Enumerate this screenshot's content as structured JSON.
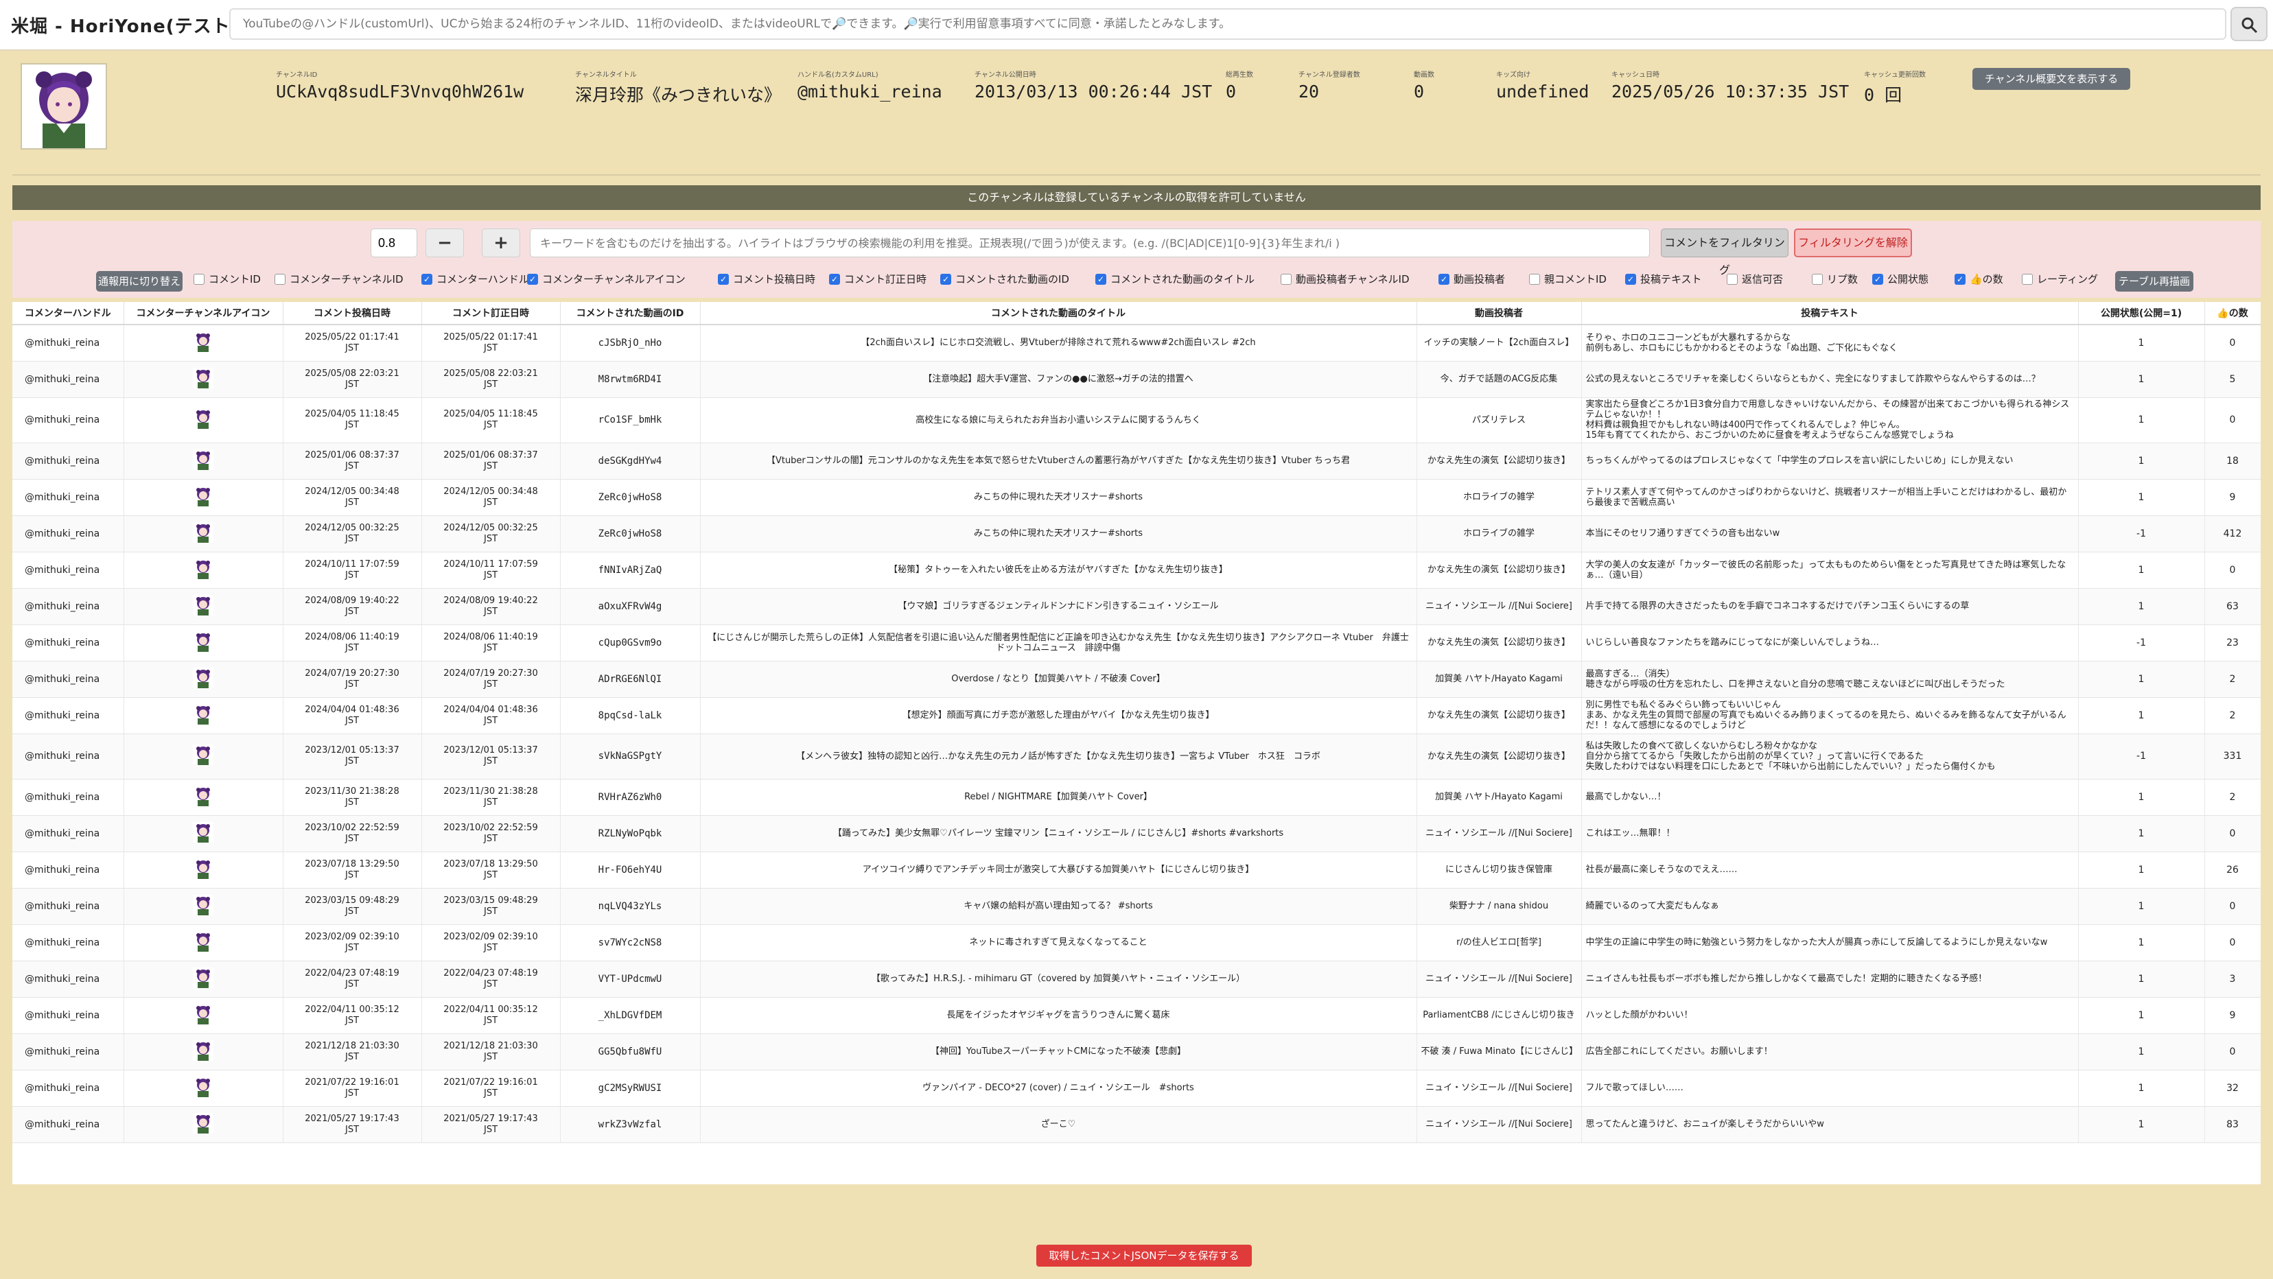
{
  "app_title": "米堀 - HoriYone(テスト中)",
  "search": {
    "placeholder": "YouTubeの@ハンドル(customUrl)、UCから始まる24桁のチャンネルID、11桁のvideoID、またはvideoURLで🔎できます。🔎実行で利用留意事項すべてに同意・承諾したとみなします。"
  },
  "channel": {
    "fields": [
      {
        "label": "チャンネルID",
        "value": "UCkAvq8sudLF3Vnvq0hW261w",
        "mono": true
      },
      {
        "label": "チャンネルタイトル",
        "value": "深月玲那《みつきれいな》",
        "mono": false
      },
      {
        "label": "ハンドル名(カスタムURL)",
        "value": "@mithuki_reina",
        "mono": true
      },
      {
        "label": "チャンネル公開日時",
        "value": "2013/03/13 00:26:44 JST",
        "mono": true
      },
      {
        "label": "総再生数",
        "value": "0",
        "mono": true
      },
      {
        "label": "チャンネル登録者数",
        "value": "20",
        "mono": true
      },
      {
        "label": "動画数",
        "value": "0",
        "mono": true
      },
      {
        "label": "キッズ向け",
        "value": "undefined",
        "mono": true
      },
      {
        "label": "キャッシュ日時",
        "value": "2025/05/26 10:37:35 JST",
        "mono": true
      },
      {
        "label": "キャッシュ更新回数",
        "value": "0 回",
        "mono": true
      }
    ],
    "summary_button": "チャンネル概要文を表示する"
  },
  "banner": "このチャンネルは登録しているチャンネルの取得を許可していません",
  "filter": {
    "threshold": "0.8",
    "minus": "−",
    "plus": "+",
    "keyword_placeholder": "キーワードを含むものだけを抽出する。ハイライトはブラウザの検索機能の利用を推奨。正規表現(/で囲う)が使えます。(e.g. /(BC|AD|CE)1[0-9]{3}年生まれ/i )",
    "filter_button": "コメントをフィルタリング",
    "clear_button": "フィルタリングを解除"
  },
  "mode_button": "通報用に切り替え",
  "redraw_button": "テーブル再描画",
  "columns_toggle": [
    {
      "label": "コメントID",
      "checked": false
    },
    {
      "label": "コメンターチャンネルID",
      "checked": false
    },
    {
      "label": "コメンターハンドル",
      "checked": true
    },
    {
      "label": "コメンターチャンネルアイコン",
      "checked": true
    },
    {
      "label": "コメント投稿日時",
      "checked": true
    },
    {
      "label": "コメント訂正日時",
      "checked": true
    },
    {
      "label": "コメントされた動画のID",
      "checked": true
    },
    {
      "label": "コメントされた動画のタイトル",
      "checked": true
    },
    {
      "label": "動画投稿者チャンネルID",
      "checked": false
    },
    {
      "label": "動画投稿者",
      "checked": true
    },
    {
      "label": "親コメントID",
      "checked": false
    },
    {
      "label": "投稿テキスト",
      "checked": true
    },
    {
      "label": "返信可否",
      "checked": false
    },
    {
      "label": "リプ数",
      "checked": false
    },
    {
      "label": "公開状態",
      "checked": true
    },
    {
      "label": "👍の数",
      "checked": true
    },
    {
      "label": "レーティング",
      "checked": false
    }
  ],
  "table": {
    "headers": [
      "コメンターハンドル",
      "コメンターチャンネルアイコン",
      "コメント投稿日時",
      "コメント訂正日時",
      "コメントされた動画のID",
      "コメントされた動画のタイトル",
      "動画投稿者",
      "投稿テキスト",
      "公開状態(公開=1)",
      "👍の数"
    ],
    "rows": [
      {
        "h": "@mithuki_reina",
        "p1": "2025/05/22 01:17:41",
        "p2": "JST",
        "e1": "2025/05/22 01:17:41",
        "e2": "JST",
        "vid": "cJSbRjO_nHo",
        "title": "【2ch面白いスレ】にじホロ交流戦し、男Vtuberが排除されて荒れるwww#2ch面白いスレ #2ch",
        "up": "イッチの実験ノート【2ch面白スレ】",
        "text": "そりゃ、ホロのユニコーンどもが大暴れするからな\n前例もあし、ホロもにじもかかわるとそのような「ぬ出題、ご下化にもぐなく",
        "pub": "1",
        "likes": "0"
      },
      {
        "h": "@mithuki_reina",
        "p1": "2025/05/08 22:03:21",
        "p2": "JST",
        "e1": "2025/05/08 22:03:21",
        "e2": "JST",
        "vid": "M8rwtm6RD4I",
        "title": "【注意喚起】超大手V運営、ファンの●●に激怒→ガチの法的措置へ",
        "up": "今、ガチで話題のACG反応集",
        "text": "公式の見えないところでリチャを楽しむくらいならともかく、完全になりすまして詐欺やらなんやらするのは…？",
        "pub": "1",
        "likes": "5"
      },
      {
        "h": "@mithuki_reina",
        "p1": "2025/04/05 11:18:45",
        "p2": "JST",
        "e1": "2025/04/05 11:18:45",
        "e2": "JST",
        "vid": "rCo1SF_bmHk",
        "title": "高校生になる娘に与えられたお弁当お小遣いシステムに関するうんちく",
        "up": "パズリテレス",
        "text": "実家出たら昼食どころか1日3食分自力で用意しなきゃいけないんだから、その練習が出来ておこづかいも得られる神システムじゃないか！！\n材料費は親負担でかもしれない時は400円で作ってくれるんでしょ？仲じゃん。\n15年も育ててくれたから、おこづかいのために昼食を考えようぜならこんな感覚でしょうね",
        "pub": "1",
        "likes": "0",
        "tall": true
      },
      {
        "h": "@mithuki_reina",
        "p1": "2025/01/06 08:37:37",
        "p2": "JST",
        "e1": "2025/01/06 08:37:37",
        "e2": "JST",
        "vid": "deSGKgdHYw4",
        "title": "【Vtuberコンサルの闇】元コンサルのかなえ先生を本気で怒らせたVtuberさんの蓄悪行為がヤバすぎた【かなえ先生切り抜き】Vtuber ちっち君",
        "up": "かなえ先生の演気【公認切り抜き】",
        "text": "ちっちくんがやってるのはプロレスじゃなくて「中学生のプロレスを言い訳にしたいじめ」にしか見えない",
        "pub": "1",
        "likes": "18"
      },
      {
        "h": "@mithuki_reina",
        "p1": "2024/12/05 00:34:48",
        "p2": "JST",
        "e1": "2024/12/05 00:34:48",
        "e2": "JST",
        "vid": "ZeRc0jwHoS8",
        "title": "みこちの仲に現れた天才リスナー#shorts",
        "up": "ホロライブの雑学",
        "text": "テトリス素人すぎて何やってんのかさっぱりわからないけど、挑戦者リスナーが相当上手いことだけはわかるし、最初から最後まで苦戦点高い",
        "pub": "1",
        "likes": "9"
      },
      {
        "h": "@mithuki_reina",
        "p1": "2024/12/05 00:32:25",
        "p2": "JST",
        "e1": "2024/12/05 00:32:25",
        "e2": "JST",
        "vid": "ZeRc0jwHoS8",
        "title": "みこちの仲に現れた天才リスナー#shorts",
        "up": "ホロライブの雑学",
        "text": "本当にそのセリフ通りすぎてぐうの音も出ないw",
        "pub": "-1",
        "likes": "412"
      },
      {
        "h": "@mithuki_reina",
        "p1": "2024/10/11 17:07:59",
        "p2": "JST",
        "e1": "2024/10/11 17:07:59",
        "e2": "JST",
        "vid": "fNNIvARjZaQ",
        "title": "【秘策】タトゥーを入れたい彼氏を止める方法がヤバすぎた【かなえ先生切り抜き】",
        "up": "かなえ先生の演気【公認切り抜き】",
        "text": "大学の美人の女友達が「カッターで彼氏の名前彫った」って太もものためらい傷をとった写真見せてきた時は寒気したなぁ…（遠い目）",
        "pub": "1",
        "likes": "0"
      },
      {
        "h": "@mithuki_reina",
        "p1": "2024/08/09 19:40:22",
        "p2": "JST",
        "e1": "2024/08/09 19:40:22",
        "e2": "JST",
        "vid": "aOxuXFRvW4g",
        "title": "【ウマ娘】ゴリラすぎるジェンティルドンナにドン引きするニュイ・ソシエール",
        "up": "ニュイ・ソシエール //[Nui Sociere]",
        "text": "片手で持てる限界の大きさだったものを手癖でコネコネするだけでパチンコ玉くらいにするの草",
        "pub": "1",
        "likes": "63"
      },
      {
        "h": "@mithuki_reina",
        "p1": "2024/08/06 11:40:19",
        "p2": "JST",
        "e1": "2024/08/06 11:40:19",
        "e2": "JST",
        "vid": "cQup0GSvm9o",
        "title": "【にじさんじが開示した荒らしの正体】人気配信者を引退に追い込んだ闇者男性配信にど正論を叩き込むかなえ先生【かなえ先生切り抜き】アクシアクローネ Vtuber　弁護士ドットコムニュース　誹謗中傷",
        "up": "かなえ先生の演気【公認切り抜き】",
        "text": "いじらしい善良なファンたちを踏みにじってなにが楽しいんでしょうね…",
        "pub": "-1",
        "likes": "23"
      },
      {
        "h": "@mithuki_reina",
        "p1": "2024/07/19 20:27:30",
        "p2": "JST",
        "e1": "2024/07/19 20:27:30",
        "e2": "JST",
        "vid": "ADrRGE6NlQI",
        "title": "Overdose / なとり【加賀美ハヤト / 不破湊 Cover】",
        "up": "加賀美 ハヤト/Hayato Kagami",
        "text": "最高すぎる…（消失）\n聴きながら呼吸の仕方を忘れたし、口を押さえないと自分の悲鳴で聴こえないほどに叫び出しそうだった",
        "pub": "1",
        "likes": "2"
      },
      {
        "h": "@mithuki_reina",
        "p1": "2024/04/04 01:48:36",
        "p2": "JST",
        "e1": "2024/04/04 01:48:36",
        "e2": "JST",
        "vid": "8pqCsd-laLk",
        "title": "【想定外】顔面写真にガチ恋が激怒した理由がヤバイ【かなえ先生切り抜き】",
        "up": "かなえ先生の演気【公認切り抜き】",
        "text": "別に男性でも私ぐるみぐらい飾ってもいいじゃん\nまあ、かなえ先生の質問で部屋の写真でもぬいぐるみ飾りまくってるのを見たら、ぬいぐるみを飾るなんて女子がいるんだ！！なんて感想になるのでしょうけど",
        "pub": "1",
        "likes": "2"
      },
      {
        "h": "@mithuki_reina",
        "p1": "2023/12/01 05:13:37",
        "p2": "JST",
        "e1": "2023/12/01 05:13:37",
        "e2": "JST",
        "vid": "sVkNaGSPgtY",
        "title": "【メンヘラ彼女】独特の認知と凶行…かなえ先生の元カノ話が怖すぎた【かなえ先生切り抜き】一宮ちよ VTuber　ホス狂　コラボ",
        "up": "かなえ先生の演気【公認切り抜き】",
        "text": "私は失敗したの食べて欲しくないからむしろ粉々かなかな\n自分から捨ててるから「失敗したから出前のが早くてい？」って言いに行くであるた\n失敗したわけではない料理を口にしたあとで「不味いから出前にしたんでいい？」だったら傷付くかも",
        "pub": "-1",
        "likes": "331",
        "tall": true
      },
      {
        "h": "@mithuki_reina",
        "p1": "2023/11/30 21:38:28",
        "p2": "JST",
        "e1": "2023/11/30 21:38:28",
        "e2": "JST",
        "vid": "RVHrAZ6zWh0",
        "title": "Rebel / NIGHTMARE【加賀美ハヤト Cover】",
        "up": "加賀美 ハヤト/Hayato Kagami",
        "text": "最高でしかない…！",
        "pub": "1",
        "likes": "2"
      },
      {
        "h": "@mithuki_reina",
        "p1": "2023/10/02 22:52:59",
        "p2": "JST",
        "e1": "2023/10/02 22:52:59",
        "e2": "JST",
        "vid": "RZLNyWoPqbk",
        "title": "【踊ってみた】美少女無罪♡パイレーツ 宝鐘マリン【ニュイ・ソシエール / にじさんじ】#shorts #varkshorts",
        "up": "ニュイ・ソシエール //[Nui Sociere]",
        "text": "これはエッ…無罪！！",
        "pub": "1",
        "likes": "0"
      },
      {
        "h": "@mithuki_reina",
        "p1": "2023/07/18 13:29:50",
        "p2": "JST",
        "e1": "2023/07/18 13:29:50",
        "e2": "JST",
        "vid": "Hr-FO6ehY4U",
        "title": "アイツコイツ縛りでアンチデッキ同士が激突して大暴びする加賀美ハヤト【にじさんじ切り抜き】",
        "up": "にじさんじ切り抜き保管庫",
        "text": "社長が最高に楽しそうなのでええ……",
        "pub": "1",
        "likes": "26"
      },
      {
        "h": "@mithuki_reina",
        "p1": "2023/03/15 09:48:29",
        "p2": "JST",
        "e1": "2023/03/15 09:48:29",
        "e2": "JST",
        "vid": "nqLVQ43zYLs",
        "title": "キャバ嬢の給料が高い理由知ってる？ #shorts",
        "up": "柴野ナナ / nana shidou",
        "text": "綺麗でいるのって大変だもんなぁ",
        "pub": "1",
        "likes": "0"
      },
      {
        "h": "@mithuki_reina",
        "p1": "2023/02/09 02:39:10",
        "p2": "JST",
        "e1": "2023/02/09 02:39:10",
        "e2": "JST",
        "vid": "sv7WYc2cNS8",
        "title": "ネットに毒されすぎて見えなくなってること",
        "up": "r/の住人ビエロ[哲学]",
        "text": "中学生の正論に中学生の時に勉強という努力をしなかった大人が腸真っ赤にして反論してるようにしか見えないなw",
        "pub": "1",
        "likes": "0"
      },
      {
        "h": "@mithuki_reina",
        "p1": "2022/04/23 07:48:19",
        "p2": "JST",
        "e1": "2022/04/23 07:48:19",
        "e2": "JST",
        "vid": "VYT-UPdcmwU",
        "title": "【歌ってみた】H.R.S.J. - mihimaru GT（covered by 加賀美ハヤト・ニュイ・ソシエール）",
        "up": "ニュイ・ソシエール //[Nui Sociere]",
        "text": "ニュイさんも社長もボーボボも推しだから推ししかなくて最高でした！定期的に聴きたくなる予感！",
        "pub": "1",
        "likes": "3"
      },
      {
        "h": "@mithuki_reina",
        "p1": "2022/04/11 00:35:12",
        "p2": "JST",
        "e1": "2022/04/11 00:35:12",
        "e2": "JST",
        "vid": "_XhLDGVfDEM",
        "title": "長尾をイジったオヤジギャグを言うりつきんに驚く葛床",
        "up": "ParliamentCB8 /にじさんじ切り抜き",
        "text": "ハッとした顔がかわいい！",
        "pub": "1",
        "likes": "9"
      },
      {
        "h": "@mithuki_reina",
        "p1": "2021/12/18 21:03:30",
        "p2": "JST",
        "e1": "2021/12/18 21:03:30",
        "e2": "JST",
        "vid": "GG5Qbfu8WfU",
        "title": "【神回】YouTubeスーパーチャットCMになった不破湊【悲劇】",
        "up": "不破 湊 / Fuwa Minato【にじさんじ】",
        "text": "広告全部これにしてください。お願いします！",
        "pub": "1",
        "likes": "0"
      },
      {
        "h": "@mithuki_reina",
        "p1": "2021/07/22 19:16:01",
        "p2": "JST",
        "e1": "2021/07/22 19:16:01",
        "e2": "JST",
        "vid": "gC2MSyRWUSI",
        "title": "ヴァンパイア - DECO*27 (cover) / ニュイ・ソシエール　#shorts",
        "up": "ニュイ・ソシエール //[Nui Sociere]",
        "text": "フルで歌ってほしい……",
        "pub": "1",
        "likes": "32"
      },
      {
        "h": "@mithuki_reina",
        "p1": "2021/05/27 19:17:43",
        "p2": "JST",
        "e1": "2021/05/27 19:17:43",
        "e2": "JST",
        "vid": "wrkZ3vWzfal",
        "title": "ざーこ♡",
        "up": "ニュイ・ソシエール //[Nui Sociere]",
        "text": "思ってたんと違うけど、おニュイが楽しそうだからいいやw",
        "pub": "1",
        "likes": "83"
      }
    ]
  },
  "save_button": "取得したコメントJSONデータを保存する"
}
